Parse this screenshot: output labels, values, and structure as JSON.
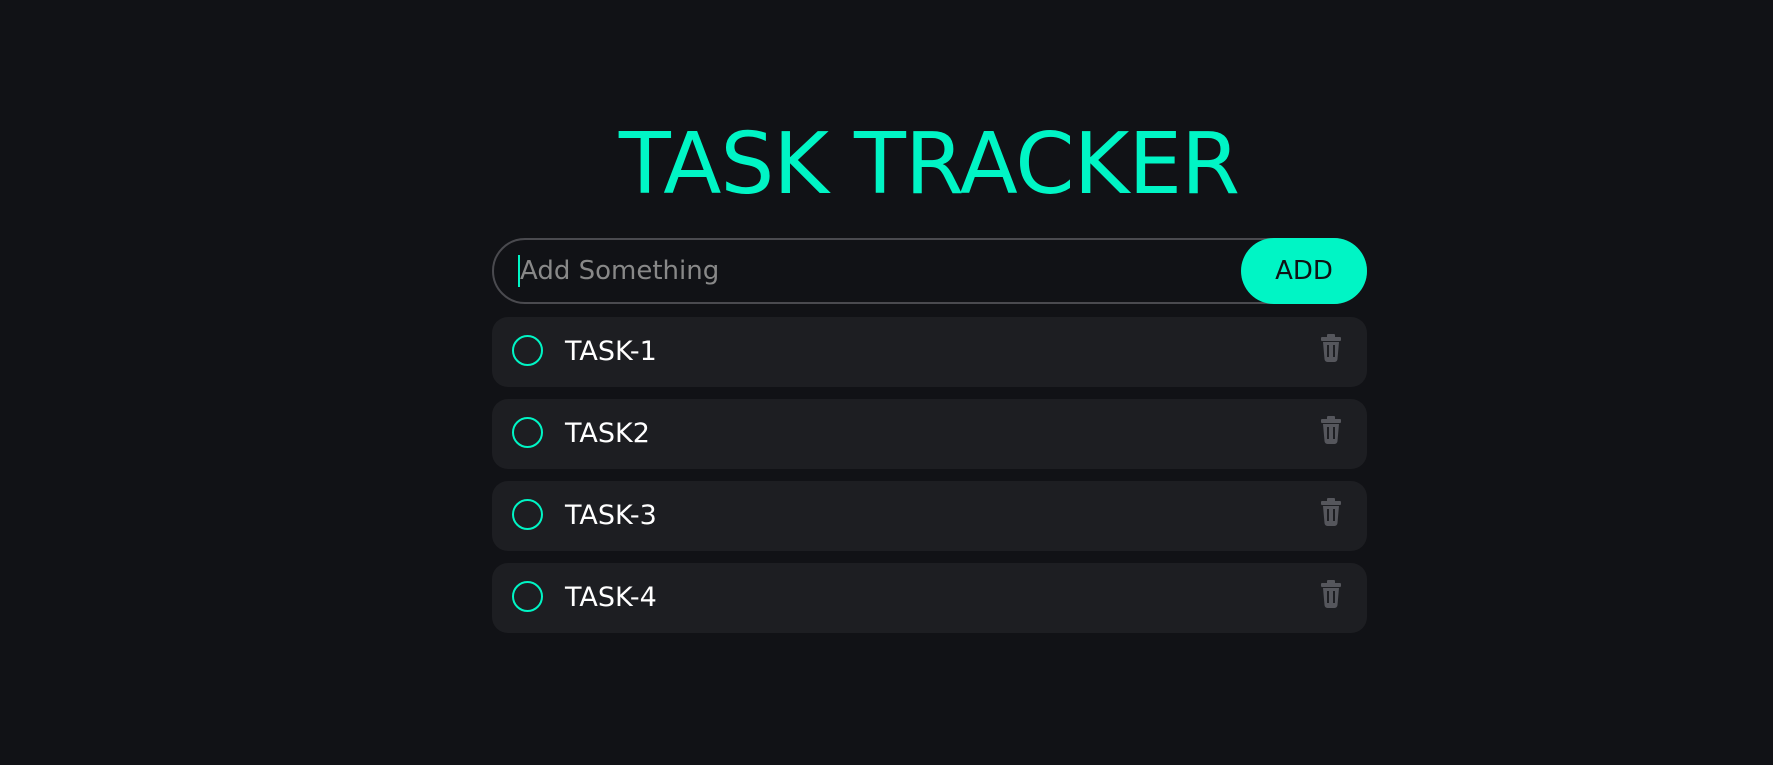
{
  "header": {
    "title": "TASK TRACKER"
  },
  "composer": {
    "placeholder": "Add Something",
    "value": "",
    "add_label": "ADD"
  },
  "tasks": [
    {
      "label": "TASK-1",
      "completed": false,
      "delete_icon": "trash-icon",
      "check_icon": "circle-icon"
    },
    {
      "label": "TASK2",
      "completed": false,
      "delete_icon": "trash-icon",
      "check_icon": "circle-icon"
    },
    {
      "label": "TASK-3",
      "completed": false,
      "delete_icon": "trash-icon",
      "check_icon": "circle-icon"
    },
    {
      "label": "TASK-4",
      "completed": false,
      "delete_icon": "trash-icon",
      "check_icon": "circle-icon"
    }
  ],
  "colors": {
    "accent": "#00f5c5",
    "background": "#111216",
    "card": "#1d1e22",
    "muted_icon": "#55565c"
  }
}
